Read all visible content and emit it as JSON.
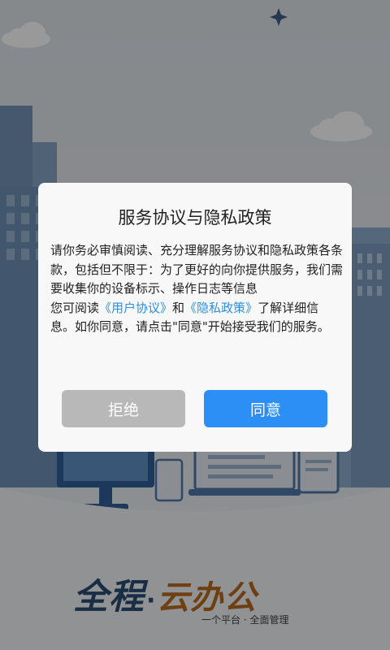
{
  "dialog": {
    "title": "服务协议与隐私政策",
    "para1": "请你务必审慎阅读、充分理解服务协议和隐私政策各条款，包括但不限于：为了更好的向你提供服务，我们需要收集你的设备标示、操作日志等信息",
    "para2_prefix": "您可阅读",
    "link_user_agreement": "《用户协议》",
    "para2_and": "和",
    "link_privacy_policy": "《隐私政策》",
    "para2_suffix": "了解详细信息。如你同意，请点击\"同意\"开始接受我们的服务。",
    "reject_label": "拒绝",
    "agree_label": "同意"
  },
  "brand": {
    "name_part1": "全程",
    "separator": "·",
    "name_part2": "云办公",
    "slogan": "一个平台 · 全面管理"
  },
  "colors": {
    "primary_button": "#2b8ff5",
    "secondary_button": "#b8b8b8",
    "link": "#2b8fe6",
    "brand_blue": "#2a4e74",
    "brand_orange": "#b86a1e"
  },
  "icons": [
    "sparkle-icon",
    "cloud-icon",
    "building-icon",
    "monitor-icon",
    "laptop-icon",
    "tablet-icon",
    "phone-icon"
  ]
}
